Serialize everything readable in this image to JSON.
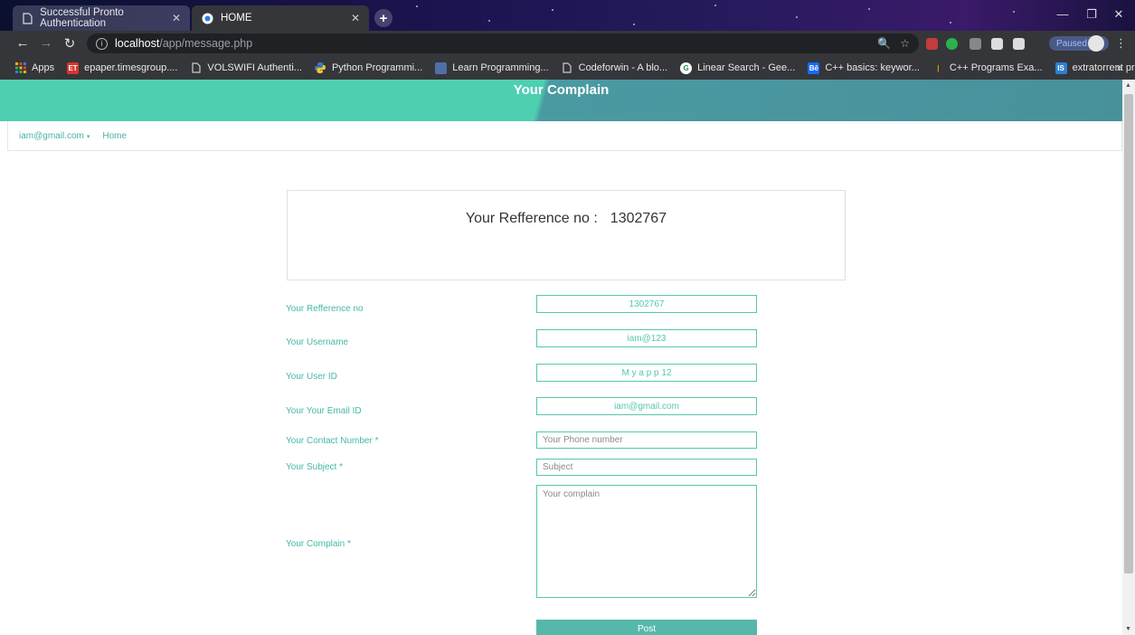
{
  "browser": {
    "tabs": [
      {
        "title": "Successful Pronto Authentication",
        "active": false
      },
      {
        "title": "HOME",
        "active": true
      }
    ],
    "url_host": "localhost",
    "url_path": "/app/message.php",
    "profile_status": "Paused",
    "bookmarks": [
      {
        "label": "Apps",
        "icon": "apps-grid-icon",
        "color": "#f5b400"
      },
      {
        "label": "epaper.timesgroup....",
        "icon": "epaper-icon",
        "color": "#d9342b"
      },
      {
        "label": "VOLSWIFI Authenti...",
        "icon": "page-icon",
        "color": "#cccccc"
      },
      {
        "label": "Python Programmi...",
        "icon": "python-icon",
        "color": "#3b7bbf"
      },
      {
        "label": "Learn Programming...",
        "icon": "learn-icon",
        "color": "#4f6fa8"
      },
      {
        "label": "Codeforwin - A blo...",
        "icon": "page-icon",
        "color": "#cccccc"
      },
      {
        "label": "Linear Search - Gee...",
        "icon": "geeks-icon",
        "color": "#2f8d46"
      },
      {
        "label": "C++ basics: keywor...",
        "icon": "be-icon",
        "color": "#1769ff"
      },
      {
        "label": "C++ Programs Exa...",
        "icon": "cpp-icon",
        "color": "#e8a000"
      },
      {
        "label": "extratorrent proxy -...",
        "icon": "is-icon",
        "color": "#2d7fd2"
      }
    ]
  },
  "page": {
    "banner_title": "Your Complain",
    "nav": {
      "user": "iam@gmail.com",
      "home": "Home"
    },
    "ref_label": "Your Refference no :",
    "ref_number": "1302767",
    "form": {
      "ref_label": "Your Refference no",
      "ref_value": "1302767",
      "username_label": "Your Username",
      "username_value": "iam@123",
      "userid_label": "Your User ID",
      "userid_value": "M y a p p 12",
      "email_label": "Your Your Email ID",
      "email_value": "iam@gmail.com",
      "contact_label": "Your Contact Number *",
      "contact_placeholder": "Your Phone number",
      "subject_label": "Your Subject *",
      "subject_placeholder": "Subject",
      "complain_label": "Your Complain *",
      "complain_placeholder": "Your complain",
      "post_label": "Post"
    }
  },
  "colors": {
    "accent": "#4ecfb0",
    "banner_dark": "#48919b",
    "label": "#43b9a6"
  }
}
